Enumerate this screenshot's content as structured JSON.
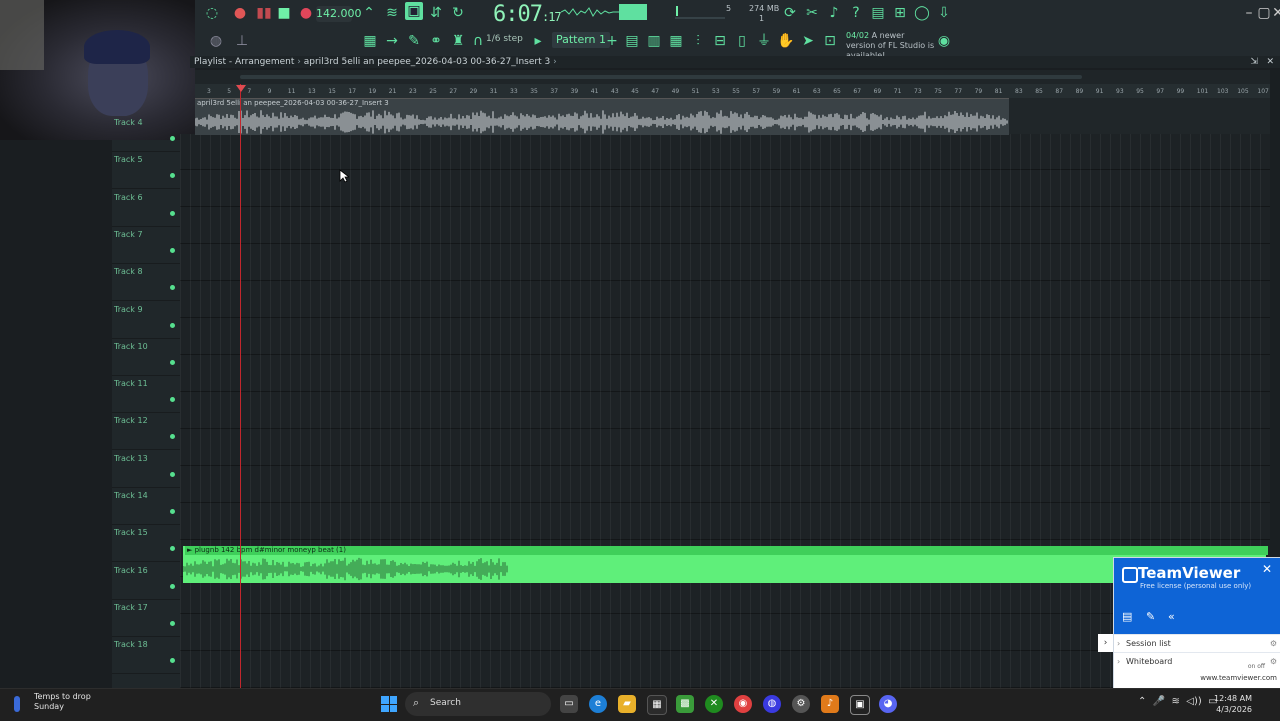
{
  "toolbar": {
    "tempo": "142.000",
    "song_time": "6:07",
    "song_time_sub": ":17",
    "step": "1/6 step",
    "pattern": "Pattern 1",
    "memory": "274 MB",
    "cpu": "5",
    "voices": "1",
    "news_date": "04/02",
    "news_text": "A newer version of FL Studio is available!"
  },
  "playlist": {
    "title": "Playlist - Arrangement",
    "breadcrumb": "april3rd 5elli an peepee_2026-04-03 00-36-27_Insert 3",
    "ruler_numbers": [
      "3",
      "5",
      "7",
      "9",
      "11",
      "13",
      "15",
      "17",
      "19",
      "21",
      "23",
      "25",
      "27",
      "29",
      "31",
      "33",
      "35",
      "37",
      "39",
      "41",
      "43",
      "45",
      "47",
      "49",
      "51",
      "53",
      "55",
      "57",
      "59",
      "61",
      "63",
      "65",
      "67",
      "69",
      "71",
      "73",
      "75",
      "77",
      "79",
      "81",
      "83",
      "85",
      "87",
      "89",
      "91",
      "93",
      "95",
      "97",
      "99",
      "101",
      "103",
      "105",
      "107"
    ],
    "top_clip_title": "april3rd 5elli an peepee_2026-04-03 00-36-27_Insert 3",
    "beat_clip_title": "► plugnb 142 bpm d#minor moneyp beat (1)",
    "tracks": [
      "Track 4",
      "Track 5",
      "Track 6",
      "Track 7",
      "Track 8",
      "Track 9",
      "Track 10",
      "Track 11",
      "Track 12",
      "Track 13",
      "Track 14",
      "Track 15",
      "Track 16",
      "Track 17",
      "Track 18"
    ]
  },
  "teamviewer": {
    "title": "TeamViewer",
    "subtitle": "Free license (personal use only)",
    "session_list": "Session list",
    "whiteboard": "Whiteboard",
    "toggle": "on  off",
    "url": "www.teamviewer.com"
  },
  "taskbar": {
    "weather_title": "Temps to drop",
    "weather_sub": "Sunday",
    "search": "Search",
    "time": "12:48 AM",
    "date": "4/3/2026"
  }
}
